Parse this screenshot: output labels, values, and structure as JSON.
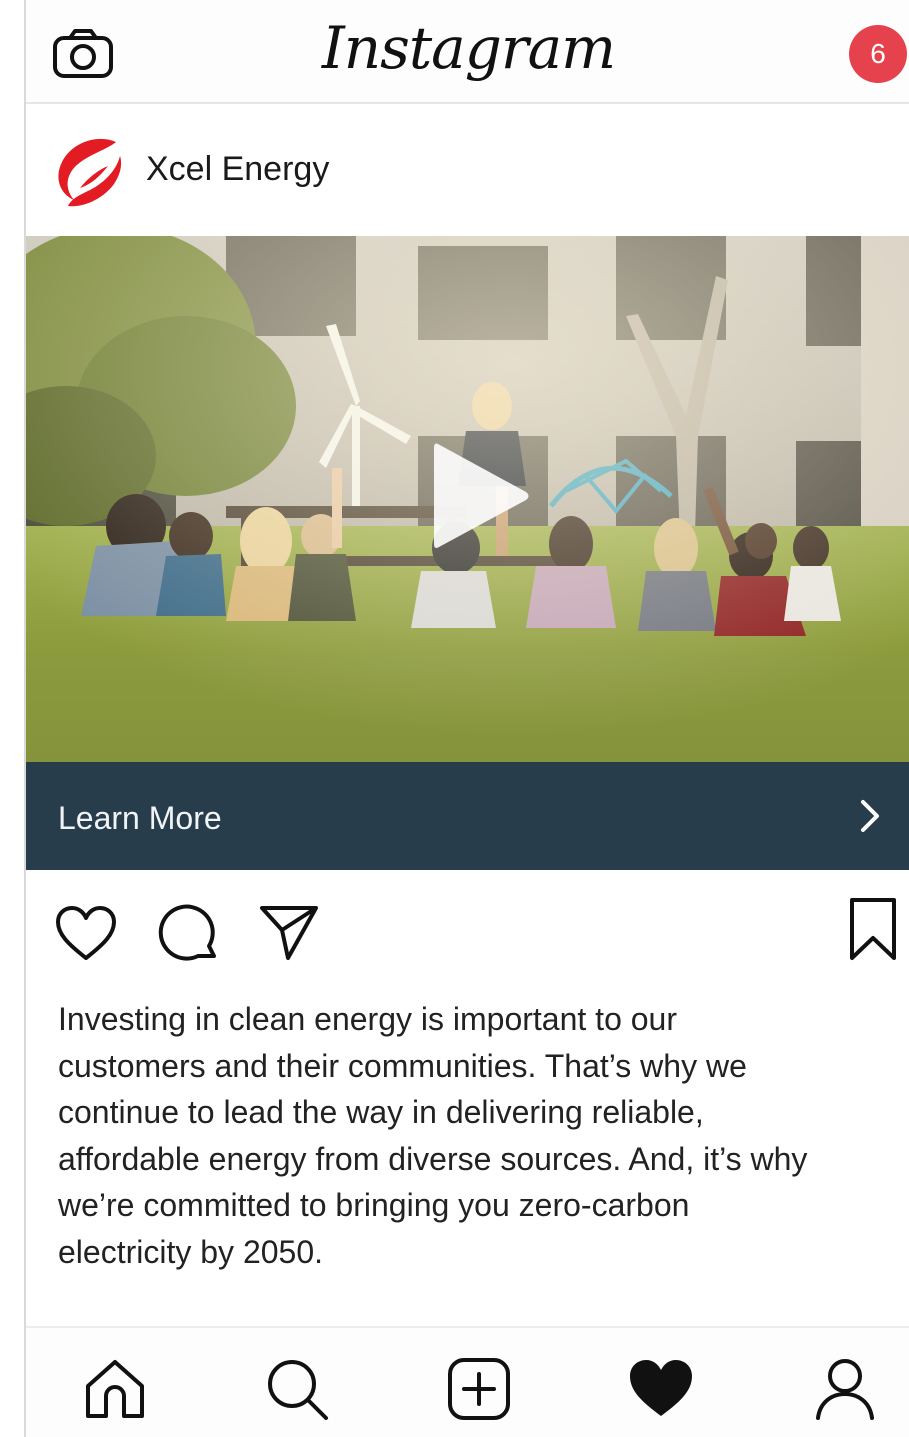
{
  "app": {
    "wordmark": "Instagram",
    "notification_count": "6",
    "badge_color": "#e5424d"
  },
  "post": {
    "account_name": "Xcel Energy",
    "logo_color": "#e31b23",
    "media_type": "video",
    "cta_label": "Learn More",
    "cta_bar_color": "#283d4c",
    "caption_lines": [
      "Investing in clean energy is important to our",
      "customers and their communities. That’s why we",
      "continue to lead the way in delivering reliable,",
      "affordable energy from diverse sources. And, it’s why",
      "we’re committed to bringing you zero-carbon",
      "electricity by 2050."
    ]
  },
  "icons": {
    "header": [
      "camera-icon"
    ],
    "actions": [
      "heart-outline-icon",
      "comment-icon",
      "send-icon",
      "bookmark-icon"
    ],
    "bottom_nav": [
      "home-icon",
      "search-icon",
      "add-post-icon",
      "activity-heart-icon",
      "profile-icon"
    ]
  }
}
